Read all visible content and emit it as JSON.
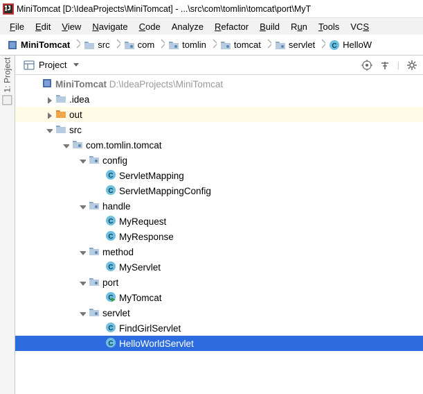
{
  "window": {
    "title_project": "MiniTomcat",
    "title_path": "[D:\\IdeaProjects\\MiniTomcat] - ...\\src\\com\\tomlin\\tomcat\\port\\MyT"
  },
  "menu": {
    "file": "File",
    "edit": "Edit",
    "view": "View",
    "navigate": "Navigate",
    "code": "Code",
    "analyze": "Analyze",
    "refactor": "Refactor",
    "build": "Build",
    "run": "Run",
    "tools": "Tools",
    "vcs": "VCS"
  },
  "breadcrumb": {
    "root": "MiniTomcat",
    "src": "src",
    "com": "com",
    "tomlin": "tomlin",
    "tomcat": "tomcat",
    "servlet": "servlet",
    "cls": "HelloW"
  },
  "toolwindow": {
    "project_label": "Project",
    "gutter_label": "1: Project"
  },
  "tree": {
    "root_name": "MiniTomcat",
    "root_path": "D:\\IdeaProjects\\MiniTomcat",
    "idea": ".idea",
    "out": "out",
    "src": "src",
    "pkg": "com.tomlin.tomcat",
    "config": "config",
    "servletMapping": "ServletMapping",
    "servletMappingConfig": "ServletMappingConfig",
    "handle": "handle",
    "myRequest": "MyRequest",
    "myResponse": "MyResponse",
    "method": "method",
    "myServlet": "MyServlet",
    "port": "port",
    "myTomcat": "MyTomcat",
    "servlet": "servlet",
    "findGirl": "FindGirlServlet",
    "hello": "HelloWorldServlet"
  }
}
